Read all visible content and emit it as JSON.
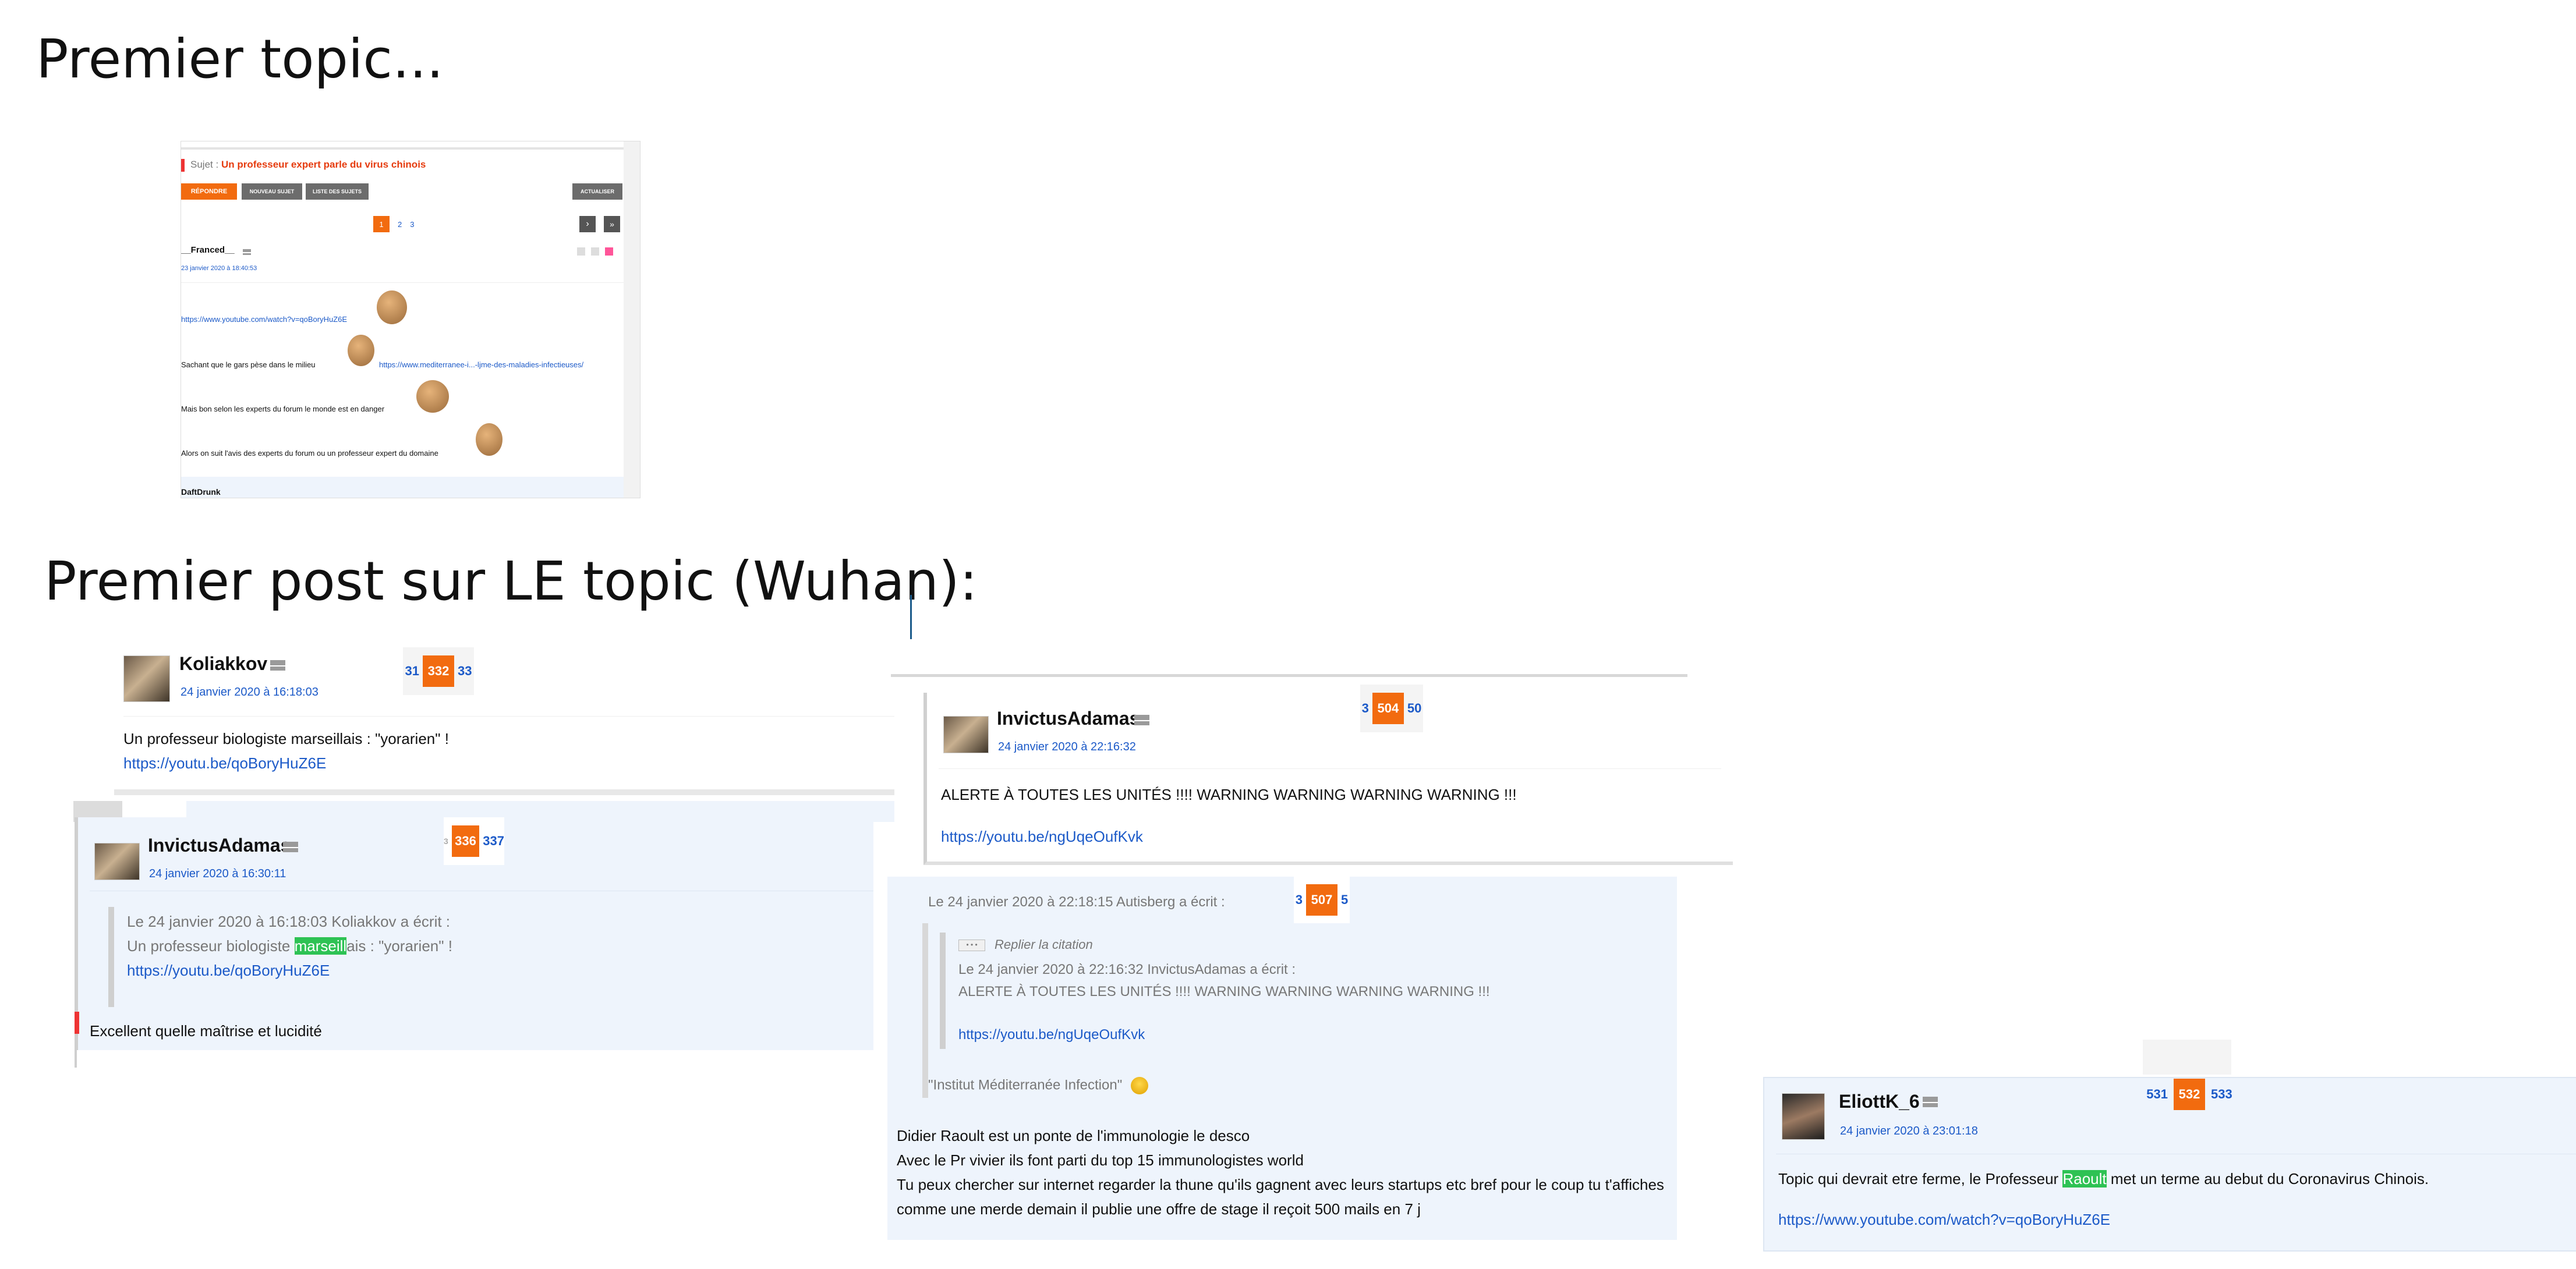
{
  "headings": {
    "first_topic": "Premier topic...",
    "first_post": "Premier post sur LE topic (Wuhan):"
  },
  "topic_shot": {
    "sujet_label": "Sujet :",
    "sujet_title": "Un professeur expert parle du virus chinois",
    "btn_reply": "RÉPONDRE",
    "btn_new": "NOUVEAU SUJET",
    "btn_list": "LISTE DES SUJETS",
    "btn_refresh": "ACTUALISER",
    "pages": [
      "1",
      "2",
      "3"
    ],
    "author": "__Franced__",
    "date": "23 janvier 2020 à 18:40:53",
    "link1": "https://www.youtube.com/watch?v=qoBoryHuZ6E",
    "line2": "Sachant que le gars pèse dans le milieu",
    "link2": "https://www.mediterranee-i...-ljme-des-maladies-infectieuses/",
    "line3": "Mais bon selon les experts du forum le monde est en danger",
    "line4": "Alors on suit l'avis des experts du forum ou un professeur expert du domaine",
    "next_author": "DaftDrunk"
  },
  "post_koliakkov": {
    "author": "Koliakkov",
    "date": "24 janvier 2020 à 16:18:03",
    "pages": [
      "31",
      "332",
      "33"
    ],
    "text": "Un professeur biologiste marseillais : \"yorarien\" !",
    "link": "https://youtu.be/qoBoryHuZ6E"
  },
  "post_invictus1": {
    "author": "InvictusAdamas",
    "date": "24 janvier 2020 à 16:30:11",
    "pages": [
      "3",
      "336",
      "337"
    ],
    "quote_header": "Le 24 janvier 2020 à 16:18:03 Koliakkov a écrit :",
    "quote_text_before": "Un professeur biologiste ",
    "quote_highlight": "marseill",
    "quote_text_after": "ais : \"yorarien\" !",
    "quote_link": "https://youtu.be/qoBoryHuZ6E",
    "reply": "Excellent quelle maîtrise et lucidité"
  },
  "post_invictus2": {
    "author": "InvictusAdamas",
    "date": "24 janvier 2020 à 22:16:32",
    "pages": [
      "3",
      "504",
      "50"
    ],
    "text": "ALERTE À TOUTES LES UNITÉS !!!! WARNING WARNING WARNING WARNING !!!",
    "link": "https://youtu.be/ngUqeOufKvk"
  },
  "post_autisberg": {
    "pages": [
      "3",
      "507",
      "5"
    ],
    "quote_header": "Le 24 janvier 2020 à 22:18:15 Autisberg a écrit :",
    "replier": "Replier la citation",
    "nested_header": "Le 24 janvier 2020 à 22:16:32 InvictusAdamas a écrit :",
    "nested_text": "ALERTE À TOUTES LES UNITÉS !!!! WARNING WARNING WARNING WARNING !!!",
    "nested_link": "https://youtu.be/ngUqeOufKvk",
    "institut": "\"Institut Méditerranée Infection\"",
    "line1": "Didier Raoult est un ponte de l'immunologie le desco",
    "line2": "Avec le Pr vivier ils font parti du top 15 immunologistes world",
    "line3": "Tu peux chercher sur internet regarder la thune qu'ils gagnent avec leurs startups etc bref pour le coup tu t'affiches",
    "line4": "comme une merde demain il publie une offre de stage il reçoit 500 mails en 7 j"
  },
  "post_eliott": {
    "author": "EliottK_6",
    "date": "24 janvier 2020 à 23:01:18",
    "pages": [
      "531",
      "532",
      "533"
    ],
    "text_before": "Topic qui devrait etre ferme, le Professeur ",
    "highlight": "Raoult",
    "text_after": " met un terme au debut du Coronavirus Chinois.",
    "link": "https://www.youtube.com/watch?v=qoBoryHuZ6E"
  },
  "colors": {
    "link": "#1c5ac8",
    "accent_orange": "#f26b0f",
    "highlight_green": "#2ec254",
    "post_bg_blue": "#eef4fc"
  },
  "icons": [
    "mail-icon",
    "avatar-image",
    "laughing-emoji-icon",
    "sticker-image",
    "next-page-icon",
    "last-page-icon"
  ]
}
